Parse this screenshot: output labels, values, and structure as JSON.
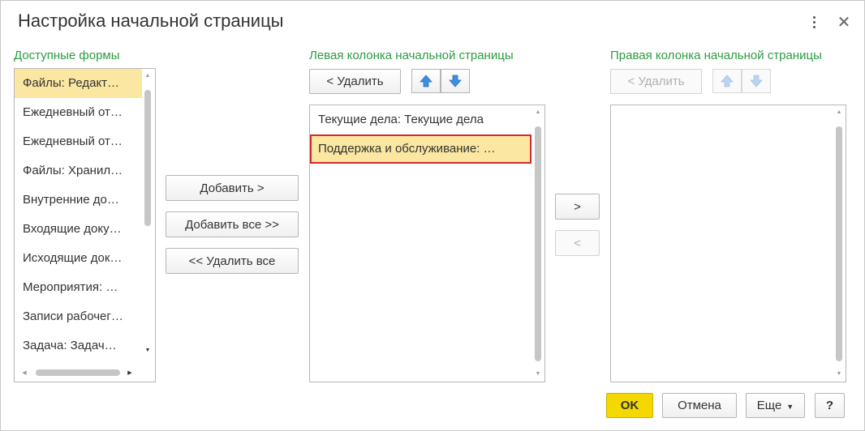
{
  "window": {
    "title": "Настройка начальной страницы",
    "menu_icon": "kebab-menu-icon",
    "close_icon": "close-icon",
    "close_glyph": "✕"
  },
  "available": {
    "label": "Доступные формы",
    "items": [
      "Файлы: Редакт…",
      "Ежедневный от…",
      "Ежедневный от…",
      "Файлы: Хранил…",
      "Внутренние до…",
      "Входящие доку…",
      "Исходящие док…",
      "Мероприятия: …",
      "Записи рабочег…",
      "Задача: Задач…"
    ],
    "selected_index": 0
  },
  "middle_buttons": {
    "add": "Добавить >",
    "add_all": "Добавить все >>",
    "remove_all": "<< Удалить все"
  },
  "left_column": {
    "label": "Левая колонка начальной страницы",
    "remove": "< Удалить",
    "items": [
      "Текущие дела: Текущие дела",
      "Поддержка и обслуживание: …"
    ],
    "selected_index": 1
  },
  "transfer_buttons": {
    "right": ">",
    "left": "<"
  },
  "right_column": {
    "label": "Правая колонка начальной страницы",
    "remove": "< Удалить",
    "items": []
  },
  "footer": {
    "ok": "OK",
    "cancel": "Отмена",
    "more": "Еще",
    "help": "?"
  },
  "colors": {
    "accent_green": "#2d9b43",
    "selection": "#fbe7a1",
    "focus_border": "#d9262c",
    "ok_button": "#f5d800",
    "arrow_blue": "#3d8fe0"
  }
}
